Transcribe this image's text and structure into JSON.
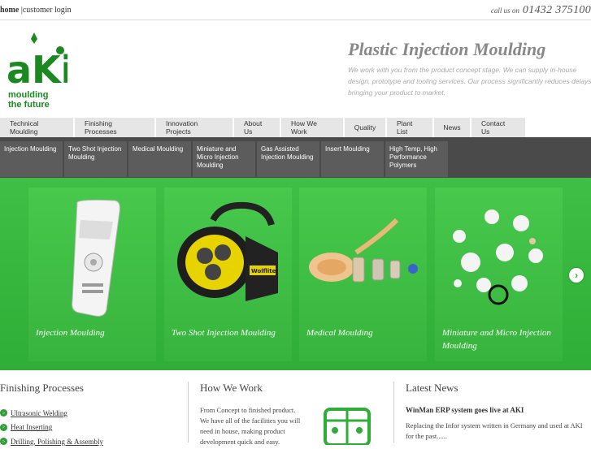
{
  "topbar": {
    "home": "home",
    "separator": "|",
    "login": "customer login",
    "call_prefix": "call us on",
    "phone": "01432 375100"
  },
  "logo": {
    "letters": "aKi",
    "line1": "moulding",
    "line2": "the future"
  },
  "intro": {
    "title": "Plastic Injection Moulding",
    "body": "We work with you from the product concept stage. We can supply in-house design, prototype and tooling services. Our process significantly reduces delays bringing your product to market."
  },
  "main_nav": [
    {
      "label": "Technical Moulding"
    },
    {
      "label": "Finishing Processes"
    },
    {
      "label": "Innovation Projects"
    },
    {
      "label": "About Us"
    },
    {
      "label": "How We Work"
    },
    {
      "label": "Quality"
    },
    {
      "label": "Plant List"
    },
    {
      "label": "News"
    },
    {
      "label": "Contact Us"
    }
  ],
  "sub_nav": [
    {
      "label": "Injection Moulding"
    },
    {
      "label": "Two Shot Injection Moulding"
    },
    {
      "label": "Medical Moulding"
    },
    {
      "label": "Miniature and Micro Injection Moulding"
    },
    {
      "label": "Gas Assisted Injection Moulding"
    },
    {
      "label": "Insert Moulding"
    },
    {
      "label": "High Temp, High Performance Polymers"
    }
  ],
  "carousel": {
    "cards": [
      {
        "label": "Injection Moulding"
      },
      {
        "label": "Two Shot Injection Moulding"
      },
      {
        "label": "Medical Moulding"
      },
      {
        "label": "Miniature and Micro Injection Moulding"
      }
    ],
    "next_glyph": "›",
    "torch_brand": "Wolflite"
  },
  "finishing": {
    "title": "Finishing Processes",
    "items": [
      {
        "label": "Ultrasonic Welding"
      },
      {
        "label": "Heat Inserting"
      },
      {
        "label": "Drilling, Polishing & Assembly"
      }
    ]
  },
  "how_we_work": {
    "title": "How We Work",
    "body": "From Concept to finished product. We have all of the facilities you will need in house, making product development quick and easy."
  },
  "news": {
    "title": "Latest News",
    "headline": "WinMan ERP system goes live at AKI",
    "body": "Replacing the Infor system written in Germany and used at AKI for the past......"
  },
  "colors": {
    "brand_green": "#2fae37",
    "nav_grey": "#e6e6e6",
    "subnav_grey": "#5c5c5c"
  }
}
